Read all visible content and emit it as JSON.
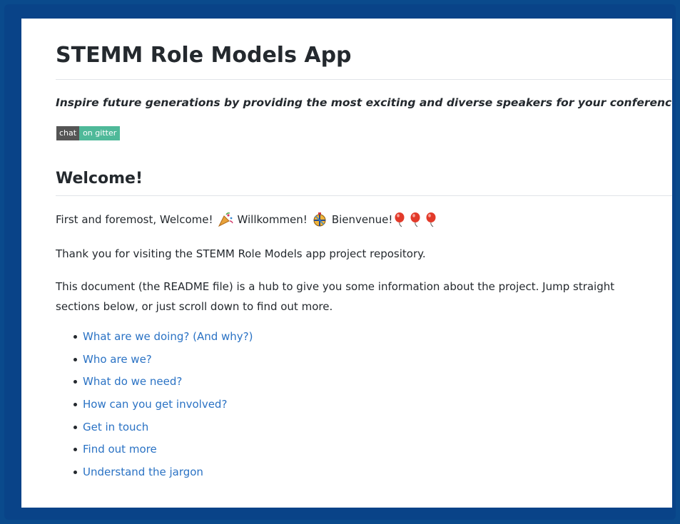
{
  "readme": {
    "title": "STEMM Role Models App",
    "tagline": "Inspire future generations by providing the most exciting and diverse speakers for your conference.",
    "badge": {
      "left": "chat",
      "right": "on gitter",
      "left_color": "#555555",
      "right_color": "#4fb999"
    },
    "welcome_heading": "Welcome!",
    "welcome_line": {
      "part1": "First and foremost, Welcome!",
      "part2": "Willkommen!",
      "part3": "Bienvenue!",
      "icons": [
        "party-popper-icon",
        "confetti-ball-icon",
        "balloon-icon",
        "balloon-icon",
        "balloon-icon"
      ]
    },
    "thanks": "Thank you for visiting the STEMM Role Models app project repository.",
    "intro_line1": "This document (the README file) is a hub to give you some information about the project. Jump straight",
    "intro_line2": "sections below, or just scroll down to find out more.",
    "links": [
      "What are we doing? (And why?)",
      "Who are we?",
      "What do we need?",
      "How can you get involved?",
      "Get in touch",
      "Find out more",
      "Understand the jargon"
    ],
    "link_color": "#2a72c4"
  }
}
